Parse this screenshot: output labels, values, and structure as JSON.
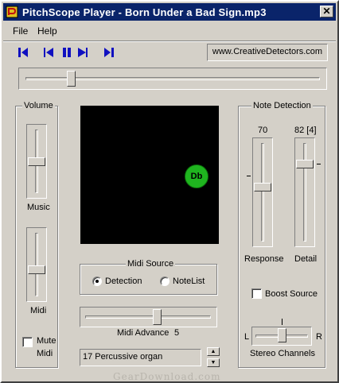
{
  "window": {
    "title": "PitchScope Player  -  Born Under a Bad Sign.mp3",
    "close_glyph": "✕"
  },
  "menu": {
    "items": [
      "File",
      "Help"
    ]
  },
  "toolbar": {
    "buttons": [
      "skip-to-start-icon",
      "previous-icon",
      "pause-icon",
      "play-icon",
      "skip-to-end-icon"
    ],
    "url": "www.CreativeDetectors.com"
  },
  "seek": {
    "position": 0.16
  },
  "volume": {
    "group_title": "Volume",
    "music_label": "Music",
    "music_level": 0.5,
    "midi_label": "Midi",
    "midi_level": 0.42,
    "mute_label_line1": "Mute",
    "mute_label_line2": "Midi",
    "mute_checked": false
  },
  "display": {
    "note": "Db",
    "note_color": "#1fb51f"
  },
  "midi_source": {
    "group_title": "Midi Source",
    "options": [
      "Detection",
      "NoteList"
    ],
    "selected": "Detection"
  },
  "midi_advance": {
    "label": "Midi Advance",
    "value": "5",
    "position": 0.57
  },
  "instrument": {
    "text": "17   Percussive organ"
  },
  "note_detection": {
    "group_title": "Note Detection",
    "response_value": "70",
    "response_label": "Response",
    "response_level": 0.55,
    "detail_value": "82 [4]",
    "detail_label": "Detail",
    "detail_level": 0.78,
    "boost_label": "Boost Source",
    "boost_checked": false
  },
  "stereo": {
    "label": "Stereo Channels",
    "left": "L",
    "right": "R",
    "position": 0.5
  },
  "watermark": "GearDownload.com"
}
